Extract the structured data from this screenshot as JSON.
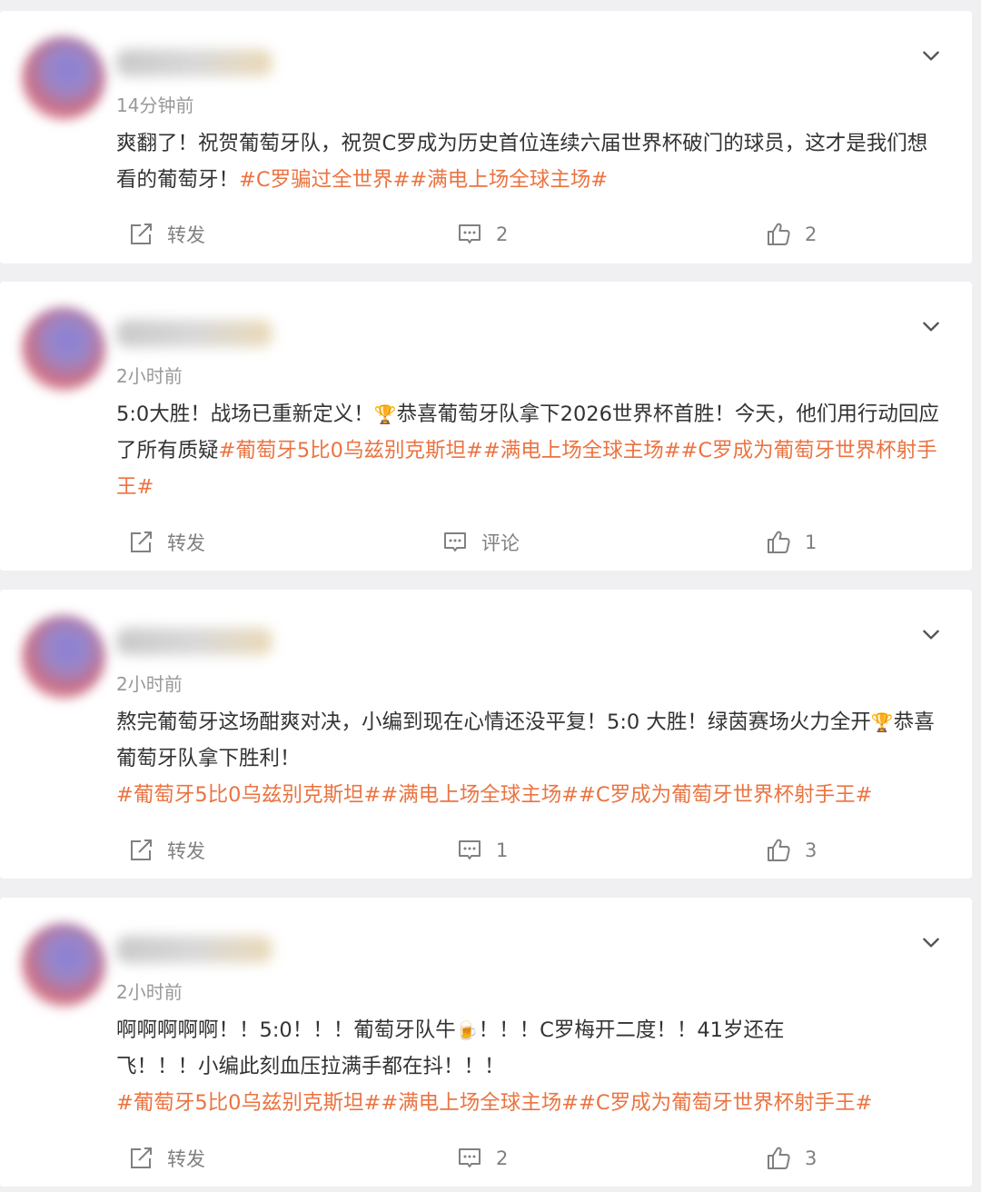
{
  "posts": [
    {
      "time": "14分钟前",
      "text": "爽翻了！祝贺葡萄牙队，祝贺C罗成为历史首位连续六届世界杯破门的球员，这才是我们想看的葡萄牙！",
      "tags": "#C罗骗过全世界##满电上场全球主场#",
      "repost_label": "转发",
      "comment_label": "2",
      "like_count": "2"
    },
    {
      "time": "2小时前",
      "text_a": "5:0大胜！战场已重新定义！",
      "trophy": "🏆",
      "text_b": "恭喜葡萄牙队拿下2026世界杯首胜！今天，他们用行动回应了所有质疑",
      "tags": "#葡萄牙5比0乌兹别克斯坦##满电上场全球主场##C罗成为葡萄牙世界杯射手王#",
      "repost_label": "转发",
      "comment_label": "评论",
      "like_count": "1"
    },
    {
      "time": "2小时前",
      "text_a": "熬完葡萄牙这场酣爽对决，小编到现在心情还没平复！5:0 大胜！绿茵赛场火力全开",
      "trophy": "🏆",
      "text_b": "恭喜葡萄牙队拿下胜利！",
      "tags": "#葡萄牙5比0乌兹别克斯坦##满电上场全球主场##C罗成为葡萄牙世界杯射手王#",
      "repost_label": "转发",
      "comment_label": "1",
      "like_count": "3"
    },
    {
      "time": "2小时前",
      "text_a": "啊啊啊啊啊！！5:0！！！葡萄牙队牛",
      "beer": "🍺",
      "text_b": "！！！C罗梅开二度！！41岁还在飞！！！小编此刻血压拉满手都在抖！！！",
      "tags": "#葡萄牙5比0乌兹别克斯坦##满电上场全球主场##C罗成为葡萄牙世界杯射手王#",
      "repost_label": "转发",
      "comment_label": "2",
      "like_count": "3"
    }
  ],
  "icons": {
    "repost": "repost-icon",
    "comment": "comment-icon",
    "like": "thumbs-up-icon",
    "more": "chevron-down-icon"
  },
  "colors": {
    "tag": "#eb7340",
    "meta": "#999999",
    "text": "#333333",
    "background": "#f0f0f2"
  }
}
